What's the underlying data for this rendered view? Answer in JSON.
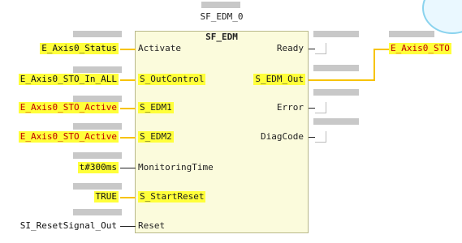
{
  "fb": {
    "instance_name": "SF_EDM_0",
    "type_name": "SF_EDM",
    "inputs": [
      {
        "pin": "Activate",
        "value": "E_Axis0_Status",
        "highlight_pin": false,
        "highlight_value": true,
        "value_red": false
      },
      {
        "pin": "S_OutControl",
        "value": "E_Axis0_STO_In_ALL",
        "highlight_pin": true,
        "highlight_value": true,
        "value_red": false
      },
      {
        "pin": "S_EDM1",
        "value": "E_Axis0_STO_Active",
        "highlight_pin": true,
        "highlight_value": true,
        "value_red": true
      },
      {
        "pin": "S_EDM2",
        "value": "E_Axis0_STO_Active",
        "highlight_pin": true,
        "highlight_value": true,
        "value_red": true
      },
      {
        "pin": "MonitoringTime",
        "value": "t#300ms",
        "highlight_pin": false,
        "highlight_value": true,
        "value_red": false
      },
      {
        "pin": "S_StartReset",
        "value": "TRUE",
        "highlight_pin": true,
        "highlight_value": true,
        "value_red": false
      },
      {
        "pin": "Reset",
        "value": "SI_ResetSignal_Out",
        "highlight_pin": false,
        "highlight_value": false,
        "value_red": false
      }
    ],
    "outputs": [
      {
        "pin": "Ready",
        "highlight": false
      },
      {
        "pin": "S_EDM_Out",
        "highlight": true,
        "connected": "E_Axis0_STO"
      },
      {
        "pin": "Error",
        "highlight": false
      },
      {
        "pin": "DiagCode",
        "highlight": false
      }
    ]
  },
  "colors": {
    "highlight": "#ffff3a",
    "wire_active": "#f7c300",
    "value_red": "#c00000",
    "block_fill": "#fbfbdc"
  }
}
